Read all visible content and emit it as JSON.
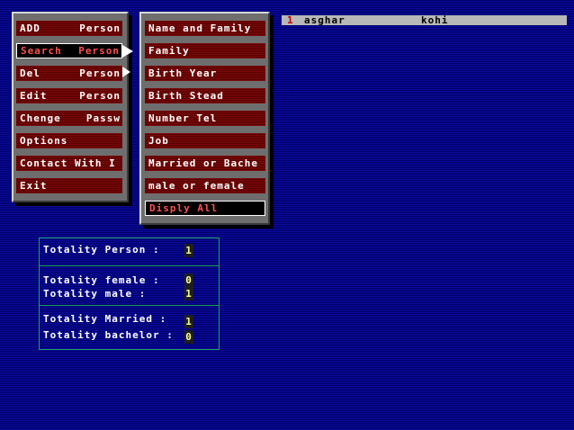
{
  "main_menu": {
    "items": [
      {
        "label_left": "ADD",
        "label_right": "Person"
      },
      {
        "label_left": "Search",
        "label_right": "Person"
      },
      {
        "label_left": "Del",
        "label_right": "Person"
      },
      {
        "label_left": "Edit",
        "label_right": "Person"
      },
      {
        "label_left": "Chenge",
        "label_right": "Passw"
      },
      {
        "label_left": "Options",
        "label_right": ""
      },
      {
        "label_left": "Contact With I",
        "label_right": ""
      },
      {
        "label_left": "Exit",
        "label_right": ""
      }
    ],
    "selected_index": 1
  },
  "search_submenu": {
    "items": [
      {
        "label": "Name and Family"
      },
      {
        "label": "Family"
      },
      {
        "label": "Birth Year"
      },
      {
        "label": "Birth Stead"
      },
      {
        "label": "Number Tel"
      },
      {
        "label": "Job"
      },
      {
        "label": "Married or Bache"
      },
      {
        "label": "male or female"
      },
      {
        "label": "Disply All"
      }
    ],
    "selected_index": 8
  },
  "result": {
    "index": "1",
    "first_name": "asghar",
    "last_name": "kohi"
  },
  "stats": {
    "totality_person_label": "Totality Person :",
    "totality_person_value": "1",
    "totality_female_label": "Totality female :",
    "totality_female_value": "0",
    "totality_male_label": "Totality male :",
    "totality_male_value": "1",
    "totality_married_label": "Totality Married :",
    "totality_married_value": "1",
    "totality_bachelor_label": "Totality bachelor :",
    "totality_bachelor_value": "0"
  },
  "colors": {
    "background": "#000080",
    "menu_item": "#6a0000",
    "selected_text": "#ff5050",
    "panel": "#6e6e6e",
    "stats_border": "#1fa060",
    "stat_value": "#ffff9a",
    "result_index": "#c00000"
  }
}
